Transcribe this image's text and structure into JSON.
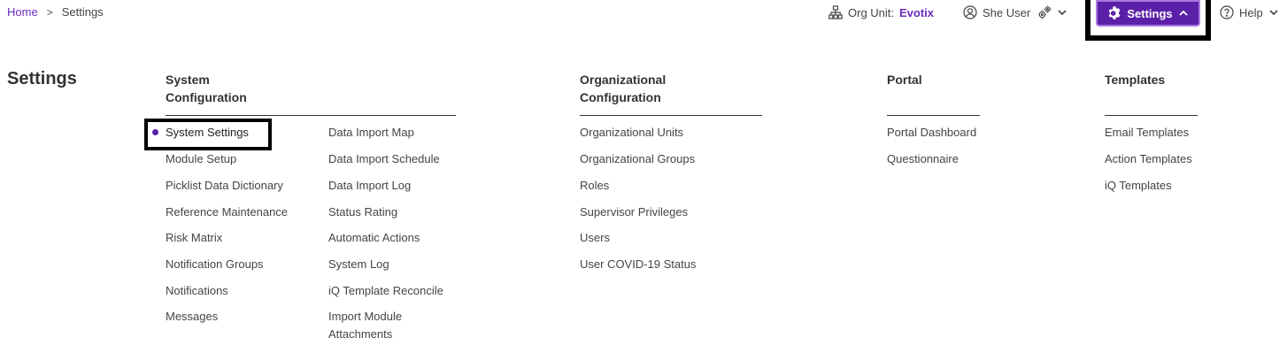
{
  "breadcrumb": {
    "home": "Home",
    "separator": ">",
    "current": "Settings"
  },
  "header": {
    "org_unit_label": "Org Unit:",
    "org_unit_value": "Evotix",
    "user_name": "She User",
    "settings_label": "Settings",
    "help_label": "Help"
  },
  "page_title": "Settings",
  "columns": {
    "system": {
      "heading_line1": "System",
      "heading_line2": "Configuration",
      "left": [
        "System Settings",
        "Module Setup",
        "Picklist Data Dictionary",
        "Reference Maintenance",
        "Risk Matrix",
        "Notification Groups",
        "Notifications",
        "Messages"
      ],
      "right": [
        "Data Import Map",
        "Data Import Schedule",
        "Data Import Log",
        "Status Rating",
        "Automatic Actions",
        "System Log",
        "iQ Template Reconcile",
        "Import Module Attachments"
      ]
    },
    "organizational": {
      "heading_line1": "Organizational",
      "heading_line2": "Configuration",
      "items": [
        "Organizational Units",
        "Organizational Groups",
        "Roles",
        "Supervisor Privileges",
        "Users",
        "User COVID-19 Status"
      ]
    },
    "portal": {
      "heading": "Portal",
      "items": [
        "Portal Dashboard",
        "Questionnaire"
      ]
    },
    "templates": {
      "heading": "Templates",
      "items": [
        "Email Templates",
        "Action Templates",
        "iQ Templates"
      ]
    }
  },
  "colors": {
    "accent": "#5b1fa8",
    "link": "#6a2bbd"
  }
}
